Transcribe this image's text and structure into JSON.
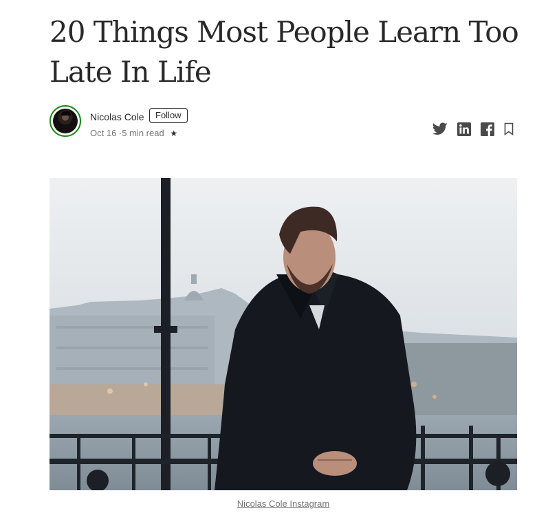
{
  "article": {
    "title": "20 Things Most People Learn Too Late In Life",
    "image_caption": "Nicolas Cole Instagram"
  },
  "author": {
    "name": "Nicolas Cole",
    "follow_label": "Follow",
    "date": "Oct 16",
    "separator": "·",
    "read_time": "5 min read",
    "member_star": "★"
  },
  "share": {
    "icons": [
      "twitter-icon",
      "linkedin-icon",
      "facebook-icon",
      "bookmark-icon"
    ]
  },
  "colors": {
    "text": "#292929",
    "meta": "#757575",
    "avatar_ring": "#1a8917"
  }
}
